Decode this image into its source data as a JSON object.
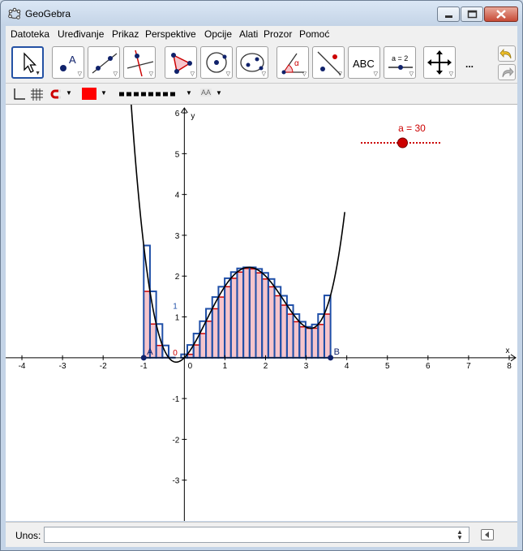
{
  "window": {
    "title": "GeoGebra"
  },
  "menu": [
    "Datoteka",
    "Uređivanje",
    "Prikaz",
    "Perspektive",
    "Opcije",
    "Alati",
    "Prozor",
    "Pomoć"
  ],
  "tools": [
    {
      "name": "move",
      "label": ""
    },
    {
      "name": "point",
      "label": "A"
    },
    {
      "name": "line",
      "label": ""
    },
    {
      "name": "perpendicular",
      "label": ""
    },
    {
      "name": "polygon",
      "label": ""
    },
    {
      "name": "circle",
      "label": ""
    },
    {
      "name": "ellipse",
      "label": ""
    },
    {
      "name": "angle",
      "label": "α"
    },
    {
      "name": "reflect",
      "label": ""
    },
    {
      "name": "text",
      "label": "ABC"
    },
    {
      "name": "slider",
      "label": "a = 2"
    },
    {
      "name": "move-view",
      "label": ""
    }
  ],
  "toolbar": {
    "more_label": "..."
  },
  "stylebar": {
    "color": "#ff0000",
    "label_style": "AA"
  },
  "slider": {
    "label": "a = 30",
    "value": 30,
    "fraction": 0.52,
    "color": "#cc0000"
  },
  "graphics": {
    "x_axis_label": "x",
    "y_axis_label": "y",
    "x_ticks": [
      -4,
      -3,
      -2,
      -1,
      0,
      1,
      2,
      3,
      4,
      5,
      6,
      7,
      8
    ],
    "y_ticks": [
      -3,
      -2,
      -1,
      1,
      2,
      3,
      4,
      5,
      6
    ],
    "origin_label": "0",
    "points": [
      {
        "name": "A",
        "x": -1,
        "y": 0
      },
      {
        "name": "B",
        "x": 3.6,
        "y": 0
      }
    ],
    "lower_sum_label": "0",
    "upper_sum_label": "1"
  },
  "chart_data": {
    "type": "line",
    "function": "f(x) = x^4/4 - 3x^3/2 + 2x^2 + x",
    "xlim": [
      -4.4,
      8.2
    ],
    "ylim": [
      -4,
      6.2
    ],
    "riemann": {
      "a": -1,
      "b": 3.6,
      "n": 30
    },
    "colors": {
      "curve": "#000000",
      "upper": "#1f4fa8",
      "lower": "#cc0000",
      "fill": "#f6c5cc",
      "point": "#10226b"
    }
  },
  "input": {
    "label": "Unos:",
    "value": ""
  }
}
